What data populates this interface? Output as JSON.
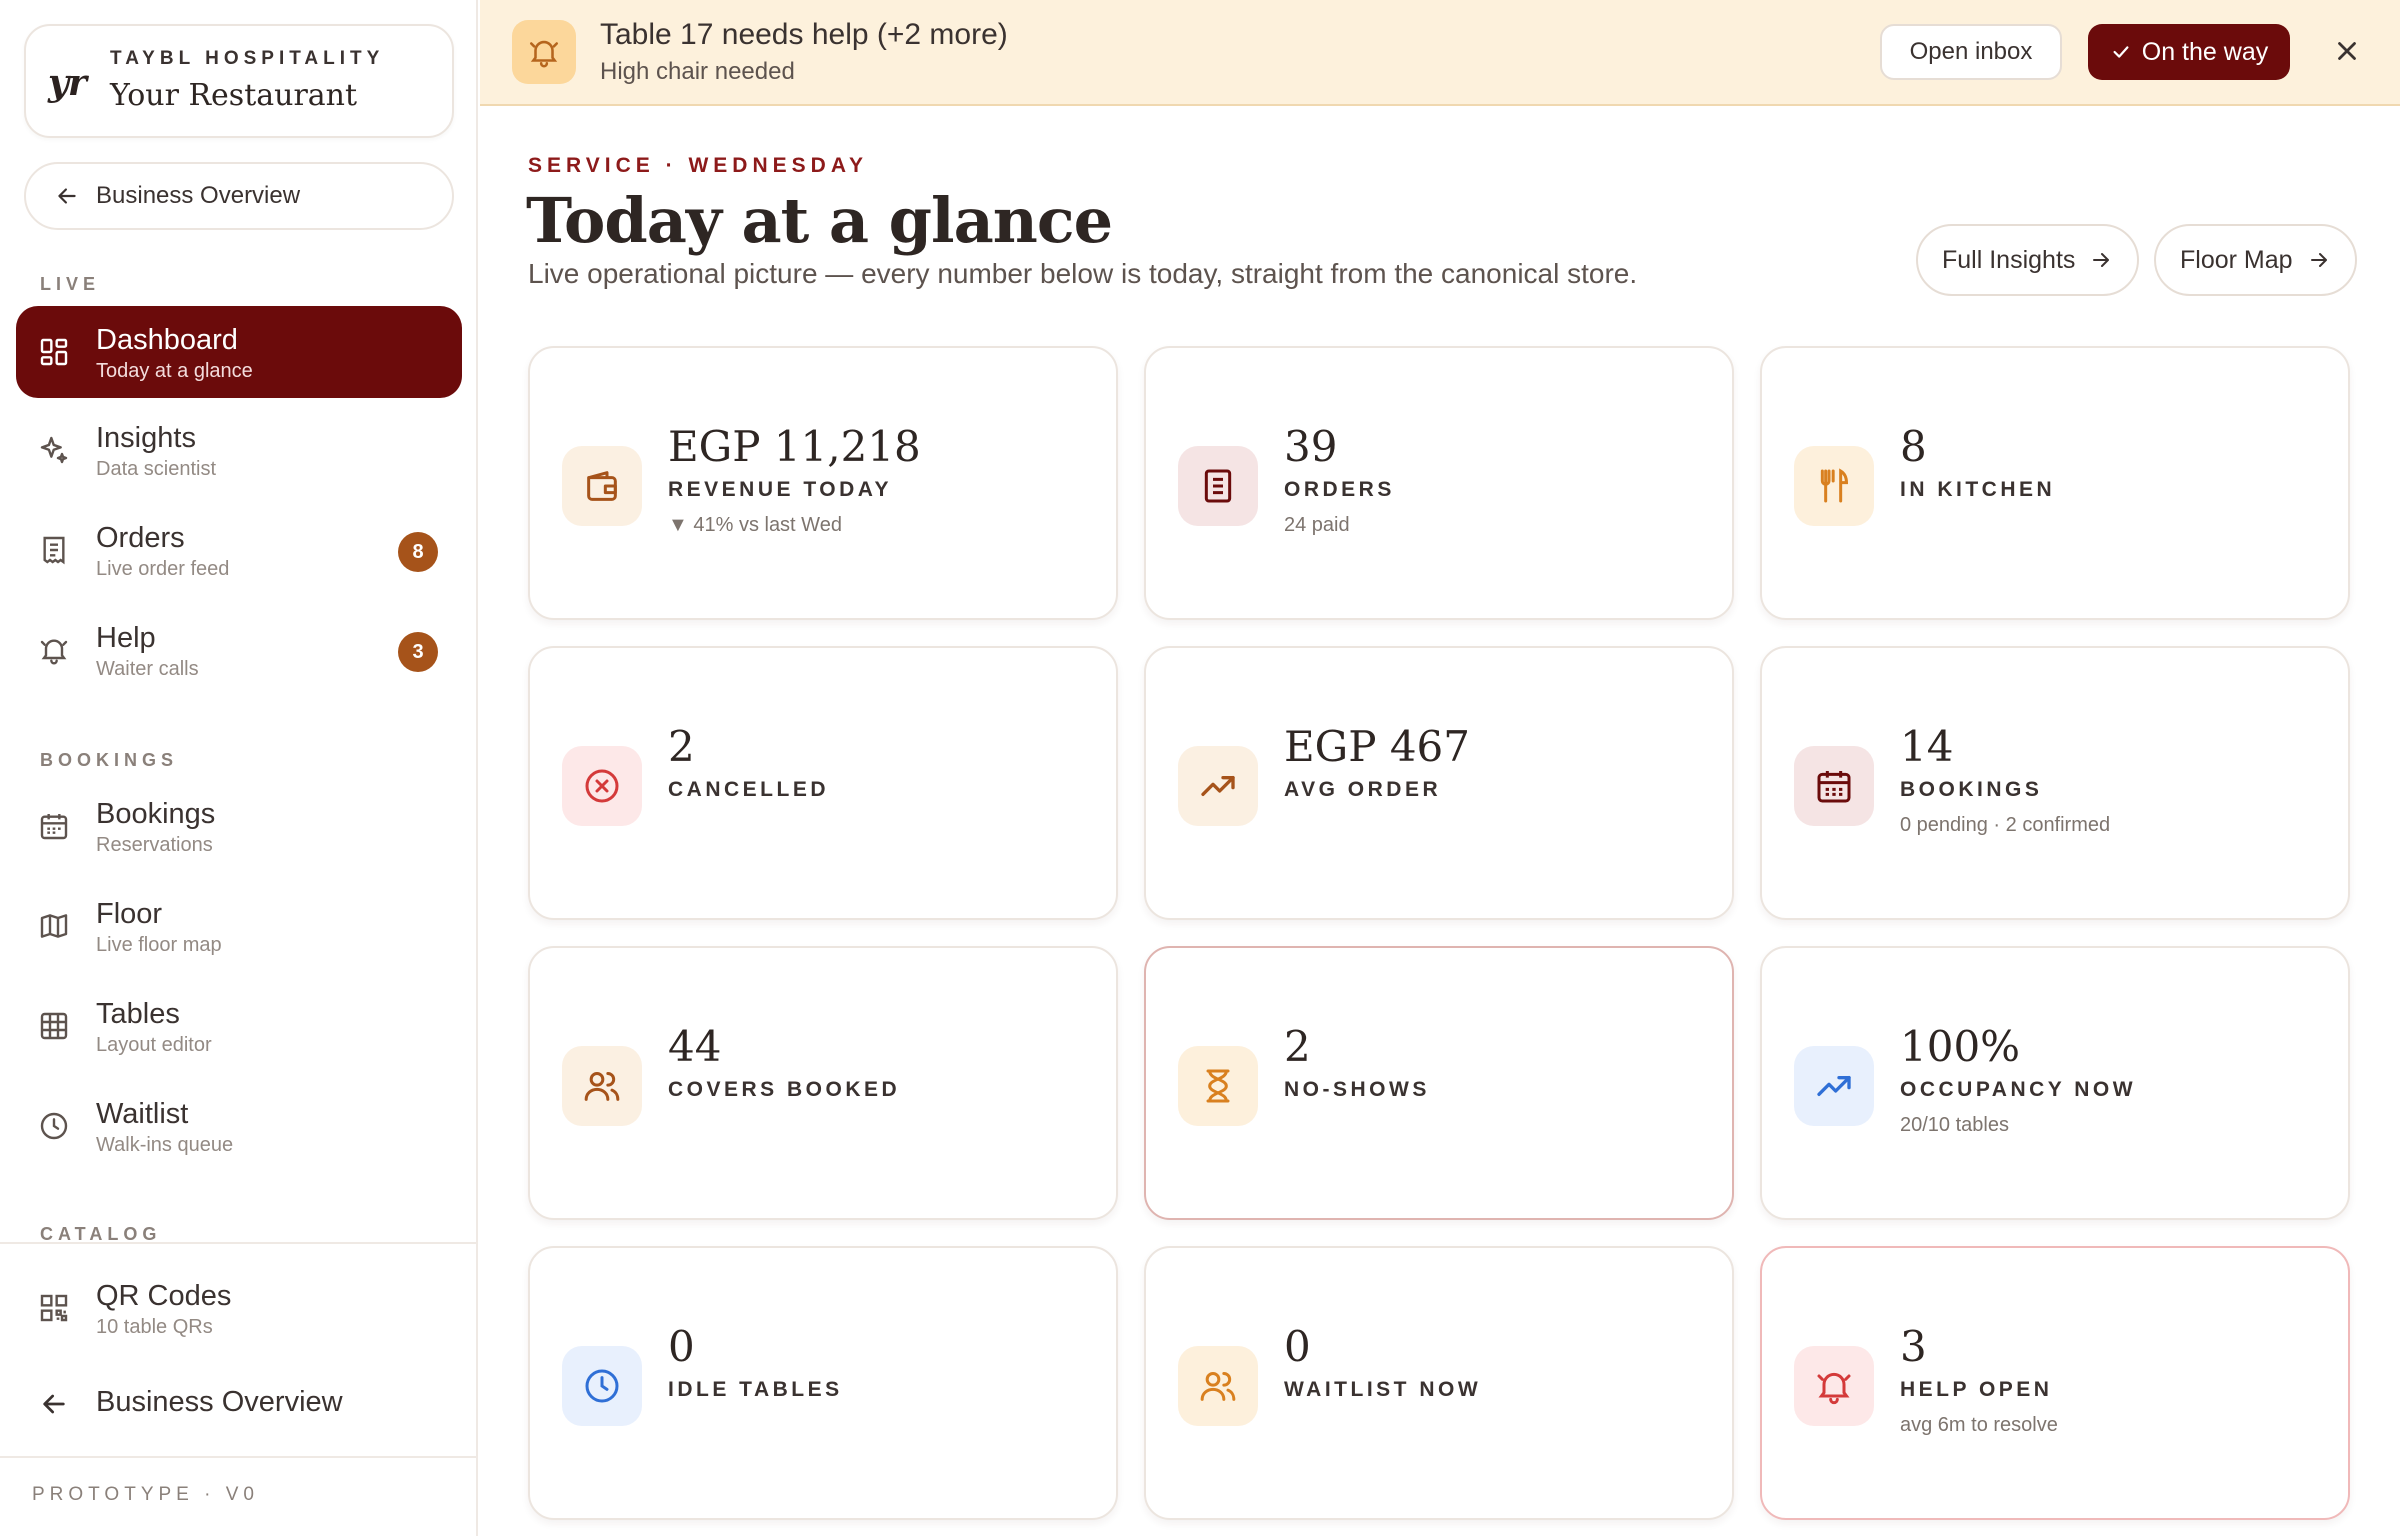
{
  "brand": {
    "logo": "yr",
    "kicker": "TAYBL HOSPITALITY",
    "name": "Your Restaurant"
  },
  "sidebar": {
    "back_label": "Business Overview",
    "sections": {
      "live": "LIVE",
      "bookings": "BOOKINGS",
      "catalog": "CATALOG"
    },
    "live_items": [
      {
        "label": "Dashboard",
        "sub": "Today at a glance"
      },
      {
        "label": "Insights",
        "sub": "Data scientist"
      },
      {
        "label": "Orders",
        "sub": "Live order feed",
        "badge": "8"
      },
      {
        "label": "Help",
        "sub": "Waiter calls",
        "badge": "3"
      }
    ],
    "booking_items": [
      {
        "label": "Bookings",
        "sub": "Reservations"
      },
      {
        "label": "Floor",
        "sub": "Live floor map"
      },
      {
        "label": "Tables",
        "sub": "Layout editor"
      },
      {
        "label": "Waitlist",
        "sub": "Walk-ins queue"
      }
    ],
    "catalog_items": [
      {
        "label": "QR Codes",
        "sub": "10 table QRs"
      }
    ],
    "bottom_back_label": "Business Overview",
    "footer": "PROTOTYPE · V0"
  },
  "alert": {
    "title": "Table 17 needs help (+2 more)",
    "sub": "High chair needed",
    "open_inbox": "Open inbox",
    "on_the_way": "On the way"
  },
  "header": {
    "kicker": "SERVICE · WEDNESDAY",
    "title": "Today at a glance",
    "subtitle": "Live operational picture — every number below is today, straight from the canonical store.",
    "full_insights": "Full Insights",
    "floor_map": "Floor Map"
  },
  "cards": [
    {
      "value": "EGP 11,218",
      "label": "REVENUE TODAY",
      "sub": "▼ 41% vs last Wed",
      "icon": "wallet-icon"
    },
    {
      "value": "39",
      "label": "ORDERS",
      "sub": "24 paid",
      "icon": "receipt-icon"
    },
    {
      "value": "8",
      "label": "IN KITCHEN",
      "sub": "",
      "icon": "utensils-icon"
    },
    {
      "value": "2",
      "label": "CANCELLED",
      "sub": "",
      "icon": "x-circle-icon"
    },
    {
      "value": "EGP 467",
      "label": "AVG ORDER",
      "sub": "",
      "icon": "trending-up-icon"
    },
    {
      "value": "14",
      "label": "BOOKINGS",
      "sub": "0 pending · 2 confirmed",
      "icon": "calendar-icon"
    },
    {
      "value": "44",
      "label": "COVERS BOOKED",
      "sub": "",
      "icon": "users-icon"
    },
    {
      "value": "2",
      "label": "NO-SHOWS",
      "sub": "",
      "icon": "hourglass-icon"
    },
    {
      "value": "100%",
      "label": "OCCUPANCY NOW",
      "sub": "20/10 tables",
      "icon": "trending-up-icon"
    },
    {
      "value": "0",
      "label": "IDLE TABLES",
      "sub": "",
      "icon": "clock-icon"
    },
    {
      "value": "0",
      "label": "WAITLIST NOW",
      "sub": "",
      "icon": "users-icon"
    },
    {
      "value": "3",
      "label": "HELP OPEN",
      "sub": "avg 6m to resolve",
      "icon": "bell-ring-icon"
    }
  ],
  "colors": {
    "brand": "#6b0b0b",
    "accent_amber": "#a6531a",
    "alert_bg": "#fdf1dc",
    "danger": "#d43a3a",
    "info_blue": "#2f6fd6"
  }
}
